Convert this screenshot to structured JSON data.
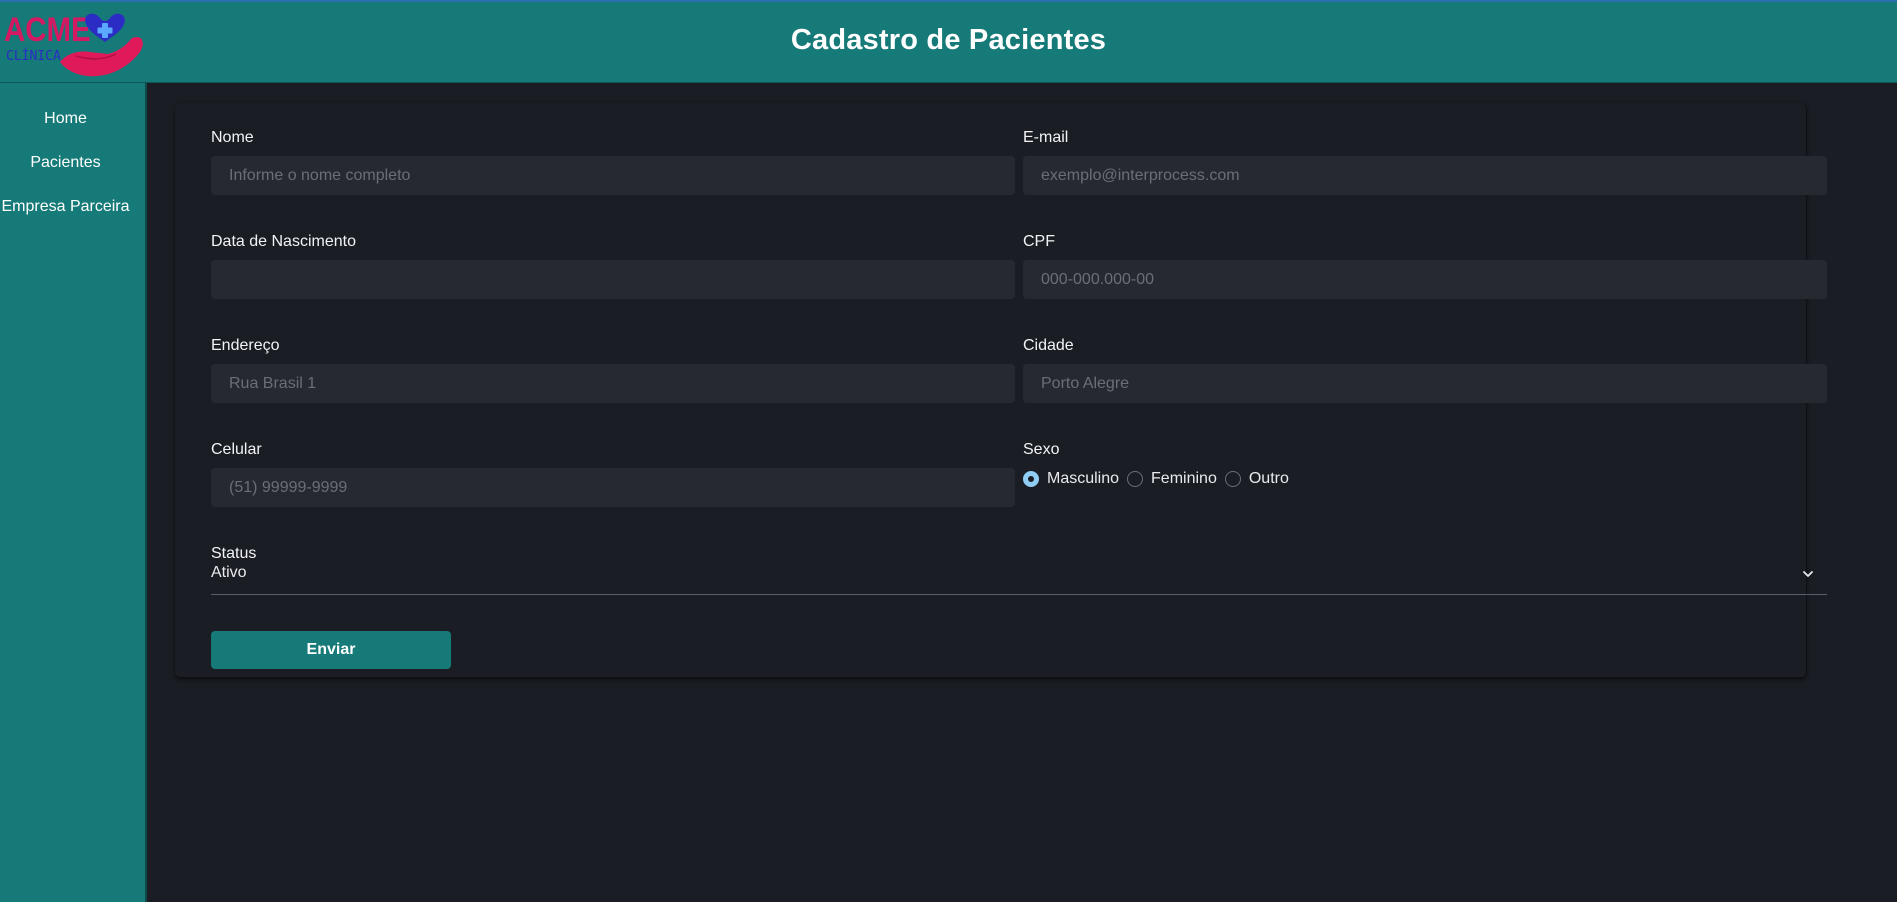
{
  "header": {
    "title": "Cadastro de Pacientes",
    "logo": {
      "line1": "ACME",
      "line2": "CLÍNICA"
    }
  },
  "sidebar": {
    "items": [
      {
        "label": "Home"
      },
      {
        "label": "Pacientes"
      },
      {
        "label": "Empresa Parceira"
      }
    ]
  },
  "form": {
    "nome": {
      "label": "Nome",
      "placeholder": "Informe o nome completo",
      "value": ""
    },
    "email": {
      "label": "E-mail",
      "placeholder": "exemplo@interprocess.com",
      "value": ""
    },
    "nascimento": {
      "label": "Data de Nascimento",
      "placeholder": "",
      "value": ""
    },
    "cpf": {
      "label": "CPF",
      "placeholder": "000-000.000-00",
      "value": ""
    },
    "endereco": {
      "label": "Endereço",
      "placeholder": "Rua Brasil 1",
      "value": ""
    },
    "cidade": {
      "label": "Cidade",
      "placeholder": "Porto Alegre",
      "value": ""
    },
    "celular": {
      "label": "Celular",
      "placeholder": "(51) 99999-9999",
      "value": ""
    },
    "sexo": {
      "label": "Sexo",
      "options": [
        {
          "label": "Masculino",
          "checked": true
        },
        {
          "label": "Feminino",
          "checked": false
        },
        {
          "label": "Outro",
          "checked": false
        }
      ]
    },
    "status": {
      "label": "Status",
      "value": "Ativo"
    },
    "submit_label": "Enviar"
  },
  "colors": {
    "brand": "#167a78",
    "background": "#1a1d24",
    "input_bg": "#262930",
    "radio_accent": "#90cdf4",
    "logo_pink": "#e0195a",
    "logo_blue": "#2a2cc4"
  },
  "icons": {
    "logo": "heart-plus-hand-icon",
    "select": "chevron-down-icon"
  }
}
